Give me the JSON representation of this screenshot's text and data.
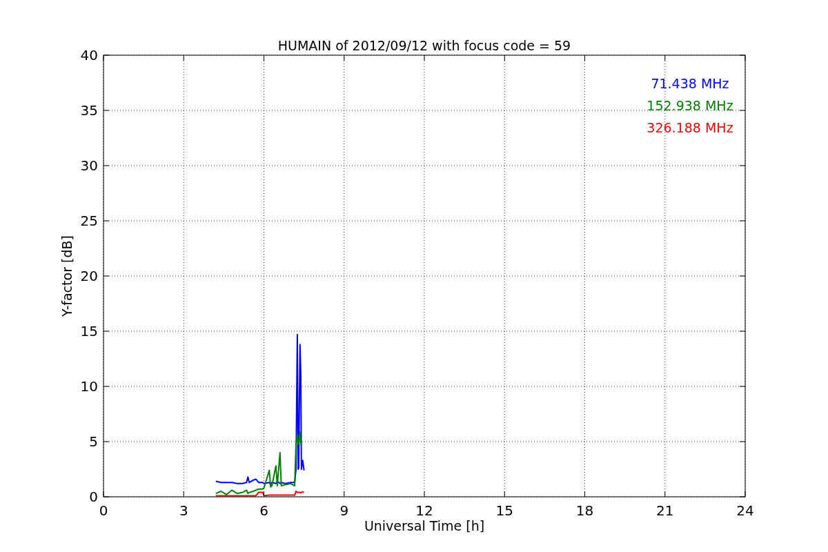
{
  "chart_data": {
    "type": "line",
    "title": "HUMAIN of 2012/09/12 with focus code = 59",
    "xlabel": "Universal Time [h]",
    "ylabel": "Y-factor [dB]",
    "x": [
      4.2,
      4.4,
      4.6,
      4.8,
      5.0,
      5.2,
      5.35,
      5.4,
      5.45,
      5.6,
      5.7,
      5.8,
      5.95,
      6.0,
      6.2,
      6.25,
      6.3,
      6.45,
      6.5,
      6.6,
      6.65,
      6.8,
      7.0,
      7.15,
      7.2,
      7.25,
      7.28,
      7.3,
      7.35,
      7.38,
      7.4,
      7.45,
      7.5
    ],
    "series": [
      {
        "name": "71.438 MHz",
        "color": "#0000ff",
        "values": [
          1.4,
          1.3,
          1.3,
          1.3,
          1.2,
          1.2,
          1.3,
          1.8,
          1.3,
          1.5,
          1.6,
          1.3,
          1.3,
          1.2,
          1.3,
          1.1,
          1.3,
          1.2,
          1.4,
          1.2,
          1.3,
          1.2,
          1.3,
          1.3,
          2.5,
          14.7,
          2.5,
          2.6,
          13.8,
          11.0,
          2.5,
          3.3,
          2.4
        ]
      },
      {
        "name": "152.938 MHz",
        "color": "#008000",
        "values": [
          0.3,
          0.5,
          0.2,
          0.6,
          0.3,
          0.4,
          0.6,
          0.3,
          0.4,
          0.5,
          0.6,
          0.7,
          0.7,
          0.8,
          2.4,
          0.9,
          1.0,
          2.8,
          1.0,
          4.0,
          1.0,
          1.1,
          1.2,
          1.0,
          4.8,
          5.6,
          4.8,
          4.8,
          5.9,
          4.8,
          5.0,
          null,
          null
        ]
      },
      {
        "name": "326.188 MHz",
        "color": "#ff0000",
        "values": [
          0.1,
          0.1,
          0.1,
          0.1,
          0.1,
          0.1,
          0.1,
          0.1,
          0.1,
          0.1,
          0.1,
          0.4,
          0.4,
          0.1,
          0.15,
          0.15,
          0.15,
          0.15,
          0.15,
          0.15,
          0.15,
          0.15,
          0.15,
          0.15,
          0.5,
          0.4,
          0.4,
          0.4,
          0.4,
          0.35,
          0.4,
          0.45,
          0.4
        ]
      }
    ],
    "grid": true,
    "xlim": [
      0,
      24
    ],
    "ylim": [
      0,
      40
    ],
    "xticks": [
      0,
      3,
      6,
      9,
      12,
      15,
      18,
      21,
      24
    ],
    "yticks": [
      0,
      5,
      10,
      15,
      20,
      25,
      30,
      35,
      40
    ]
  }
}
